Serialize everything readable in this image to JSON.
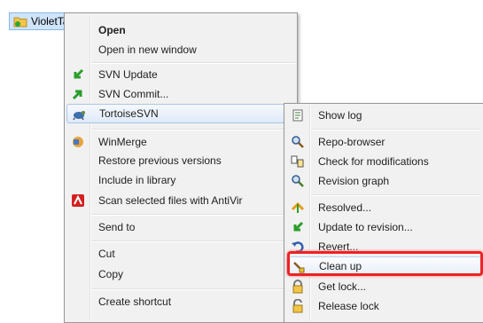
{
  "folder": {
    "label": "VioletTa"
  },
  "main_menu": [
    {
      "key": "open",
      "label": "Open",
      "bold": true,
      "icon": "none"
    },
    {
      "key": "open-new-window",
      "label": "Open in new window",
      "icon": "none"
    },
    {
      "key": "svn-update",
      "label": "SVN Update",
      "icon": "svn-update-icon"
    },
    {
      "key": "svn-commit",
      "label": "SVN Commit...",
      "icon": "svn-commit-icon"
    },
    {
      "key": "tortoisesvn",
      "label": "TortoiseSVN",
      "icon": "tortoise-icon",
      "submenu": true
    },
    {
      "key": "winmerge",
      "label": "WinMerge",
      "icon": "winmerge-icon"
    },
    {
      "key": "restore-previous-versions",
      "label": "Restore previous versions",
      "icon": "none"
    },
    {
      "key": "include-in-library",
      "label": "Include in library",
      "icon": "none",
      "submenu": true
    },
    {
      "key": "scan-antivir",
      "label": "Scan selected files with AntiVir",
      "icon": "antivir-icon"
    },
    {
      "key": "send-to",
      "label": "Send to",
      "icon": "none",
      "submenu": true
    },
    {
      "key": "cut",
      "label": "Cut",
      "icon": "none"
    },
    {
      "key": "copy",
      "label": "Copy",
      "icon": "none"
    },
    {
      "key": "create-shortcut",
      "label": "Create shortcut",
      "icon": "none"
    }
  ],
  "sub_menu": [
    {
      "key": "show-log",
      "label": "Show log",
      "icon": "show-log-icon"
    },
    {
      "key": "repo-browser",
      "label": "Repo-browser",
      "icon": "repo-browser-icon"
    },
    {
      "key": "check-modifications",
      "label": "Check for modifications",
      "icon": "check-modifications-icon"
    },
    {
      "key": "revision-graph",
      "label": "Revision graph",
      "icon": "revision-graph-icon"
    },
    {
      "key": "resolved",
      "label": "Resolved...",
      "icon": "resolved-icon"
    },
    {
      "key": "update-to-revision",
      "label": "Update to revision...",
      "icon": "update-revision-icon"
    },
    {
      "key": "revert",
      "label": "Revert...",
      "icon": "revert-icon"
    },
    {
      "key": "clean-up",
      "label": "Clean up",
      "icon": "clean-up-icon"
    },
    {
      "key": "get-lock",
      "label": "Get lock...",
      "icon": "lock-icon"
    },
    {
      "key": "release-lock",
      "label": "Release lock",
      "icon": "unlock-icon"
    }
  ],
  "colors": {
    "highlight_border": "#ee2222",
    "hover_border": "#a9c6ea",
    "svn_green": "#2a9d2a",
    "antivir_red": "#d42020"
  }
}
